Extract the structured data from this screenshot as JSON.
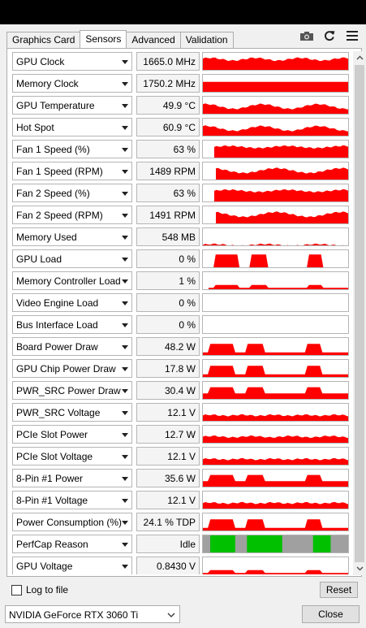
{
  "tabs": [
    {
      "label": "Graphics Card",
      "active": false
    },
    {
      "label": "Sensors",
      "active": true
    },
    {
      "label": "Advanced",
      "active": false
    },
    {
      "label": "Validation",
      "active": false
    }
  ],
  "toolbar": {
    "icons": [
      "camera-icon",
      "refresh-icon",
      "hamburger-menu-icon"
    ]
  },
  "sensors": [
    {
      "label": "GPU Clock",
      "value": "1665.0 MHz",
      "graph": "high"
    },
    {
      "label": "Memory Clock",
      "value": "1750.2 MHz",
      "graph": "full"
    },
    {
      "label": "GPU Temperature",
      "value": "49.9 °C",
      "graph": "wavy"
    },
    {
      "label": "Hot Spot",
      "value": "60.9 °C",
      "graph": "wavy"
    },
    {
      "label": "Fan 1 Speed (%)",
      "value": "63 %",
      "graph": "fan"
    },
    {
      "label": "Fan 1 Speed (RPM)",
      "value": "1489 RPM",
      "graph": "fanrpm"
    },
    {
      "label": "Fan 2 Speed (%)",
      "value": "63 %",
      "graph": "fan"
    },
    {
      "label": "Fan 2 Speed (RPM)",
      "value": "1491 RPM",
      "graph": "fanrpm"
    },
    {
      "label": "Memory Used",
      "value": "548 MB",
      "graph": "low"
    },
    {
      "label": "GPU Load",
      "value": "0 %",
      "graph": "load"
    },
    {
      "label": "Memory Controller Load",
      "value": "1 %",
      "graph": "memload"
    },
    {
      "label": "Video Engine Load",
      "value": "0 %",
      "graph": "none"
    },
    {
      "label": "Bus Interface Load",
      "value": "0 %",
      "graph": "none"
    },
    {
      "label": "Board Power Draw",
      "value": "48.2 W",
      "graph": "power"
    },
    {
      "label": "GPU Chip Power Draw",
      "value": "17.8 W",
      "graph": "power"
    },
    {
      "label": "PWR_SRC Power Draw",
      "value": "30.4 W",
      "graph": "power2"
    },
    {
      "label": "PWR_SRC Voltage",
      "value": "12.1 V",
      "graph": "volt"
    },
    {
      "label": "PCIe Slot Power",
      "value": "12.7 W",
      "graph": "slot"
    },
    {
      "label": "PCIe Slot Voltage",
      "value": "12.1 V",
      "graph": "volt"
    },
    {
      "label": "8-Pin #1 Power",
      "value": "35.6 W",
      "graph": "power2"
    },
    {
      "label": "8-Pin #1 Voltage",
      "value": "12.1 V",
      "graph": "volt"
    },
    {
      "label": "Power Consumption (%)",
      "value": "24.1 % TDP",
      "graph": "power"
    },
    {
      "label": "PerfCap Reason",
      "value": "Idle",
      "graph": "perfcap"
    },
    {
      "label": "GPU Voltage",
      "value": "0.8430 V",
      "graph": "gvolt"
    }
  ],
  "bottom": {
    "log_label": "Log to file",
    "log_checked": false,
    "reset_label": "Reset",
    "gpu_select_value": "NVIDIA GeForce RTX 3060 Ti",
    "close_label": "Close"
  },
  "colors": {
    "graph": "#ff0000",
    "perfcap_green": "#00c000",
    "perfcap_gray": "#a0a0a0"
  }
}
